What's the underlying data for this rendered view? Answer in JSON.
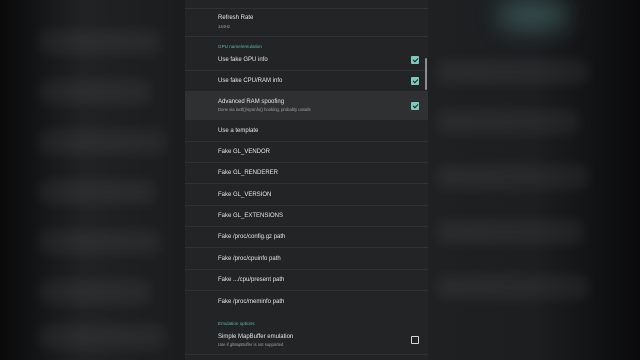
{
  "settings": {
    "refresh_rate": {
      "title": "Refresh Rate",
      "summary": "144Hz"
    },
    "gpu_section": "GPU name/emulation",
    "fake_gpu_info": {
      "title": "Use fake GPU info",
      "checked": true
    },
    "fake_cpu_ram": {
      "title": "Use fake CPU/RAM info",
      "checked": true
    },
    "ram_spoofing": {
      "title": "Advanced RAM spoofing",
      "summary": "Done via ioctl()/sysinfo() hooking, probably unsafe",
      "checked": true
    },
    "use_template": {
      "title": "Use a template"
    },
    "gl_vendor": {
      "title": "Fake GL_VENDOR"
    },
    "gl_renderer": {
      "title": "Fake GL_RENDERER"
    },
    "gl_version": {
      "title": "Fake GL_VERSION"
    },
    "gl_extensions": {
      "title": "Fake GL_EXTENSIONS"
    },
    "config_gz": {
      "title": "Fake /proc/config.gz path"
    },
    "cpuinfo": {
      "title": "Fake /proc/cpuinfo path"
    },
    "cpu_present": {
      "title": "Fake .../cpu/present path"
    },
    "meminfo": {
      "title": "Fake /proc/meminfo path"
    },
    "emulation_section": "Emulation options",
    "mapbuffer": {
      "title": "Simple MapBuffer emulation",
      "summary": "Use if glMapBuffer is not supported",
      "checked": false
    }
  },
  "colors": {
    "accent": "#5fb9ad",
    "checkbox_fill": "#7cc9bd",
    "panel_bg": "#232425",
    "highlight_bg": "#2f3032",
    "divider": "#2f3132"
  }
}
